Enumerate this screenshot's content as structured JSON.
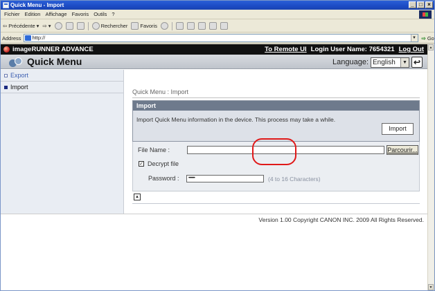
{
  "window": {
    "title": "Quick Menu - Import",
    "controls": [
      "_",
      "□",
      "×"
    ]
  },
  "menubar": {
    "items": [
      "Fichier",
      "Edition",
      "Affichage",
      "Favoris",
      "Outils",
      "?"
    ]
  },
  "toolbar": {
    "back_label": "Précédente",
    "search_label": "Rechercher",
    "favorites_label": "Favoris"
  },
  "addressbar": {
    "label": "Address",
    "url": "http://",
    "go_label": "Go"
  },
  "header": {
    "brand": "imageRUNNER ADVANCE",
    "to_remote_ui": "To Remote UI",
    "login_user": "Login User Name: 7654321",
    "logout": "Log Out"
  },
  "quickmenu": {
    "title": "Quick Menu",
    "language_label": "Language:",
    "language_value": "English"
  },
  "sidebar": {
    "items": [
      {
        "label": "Export",
        "active": false
      },
      {
        "label": "Import",
        "active": true
      }
    ]
  },
  "main": {
    "breadcrumb": "Quick Menu : Import",
    "panel_title": "Import",
    "panel_text": "Import Quick Menu information in the device. This process may take a while.",
    "import_button": "Import",
    "file_name_label": "File Name :",
    "browse_button": "Parcourir...",
    "decrypt_label": "Decrypt file",
    "decrypt_checked": true,
    "password_label": "Password :",
    "password_value": "••••••••",
    "password_hint": "(4 to 16 Characters)"
  },
  "footer": {
    "copyright": "Version 1.00 Copyright CANON INC. 2009 All Rights Reserved."
  },
  "colors": {
    "titlebar": "#1c4bc4",
    "header_black": "#111111",
    "highlight_red": "#e01818"
  }
}
